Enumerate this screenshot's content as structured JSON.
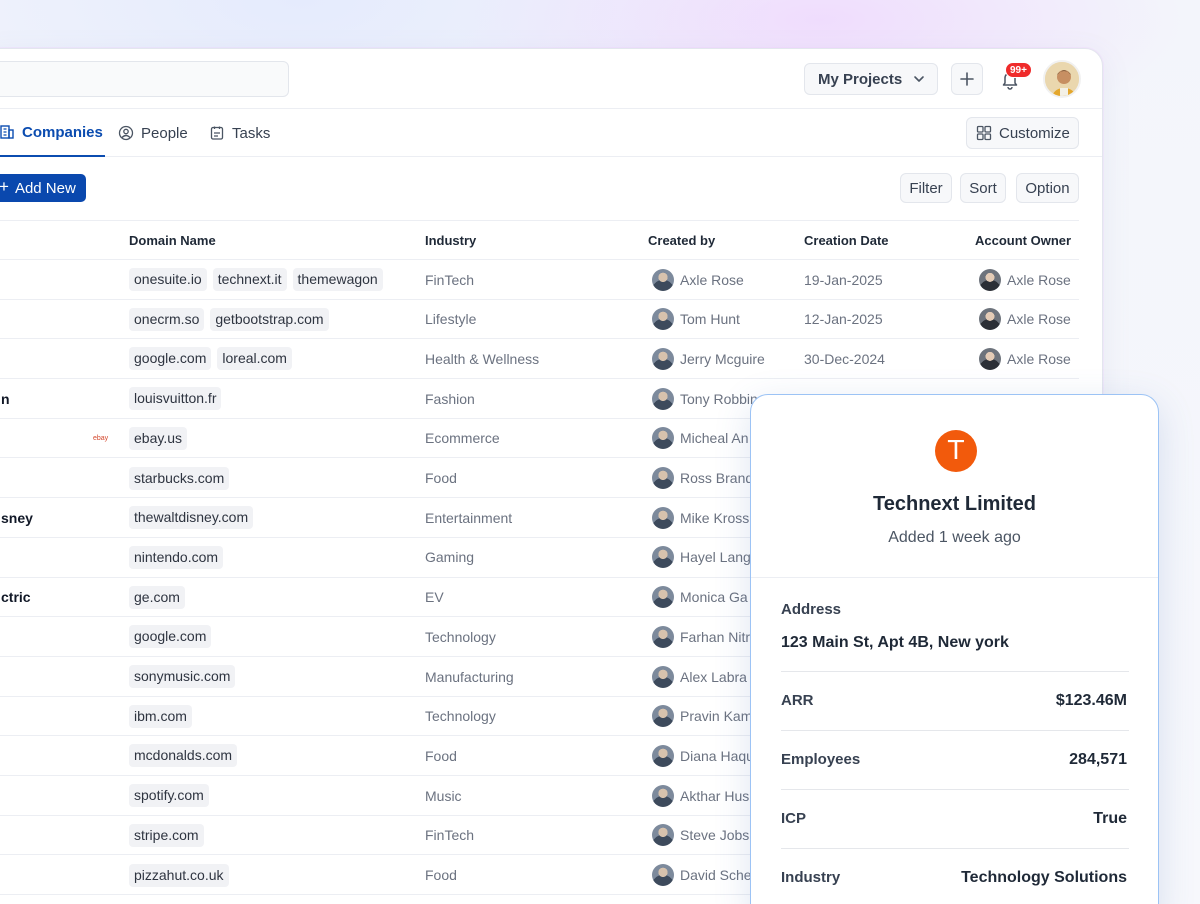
{
  "topbar": {
    "projects_label": "My Projects",
    "notification_count": "99+"
  },
  "tabs": [
    {
      "label": "Companies",
      "icon": "building-icon",
      "active": true
    },
    {
      "label": "People",
      "icon": "person-circle-icon",
      "active": false
    },
    {
      "label": "Tasks",
      "icon": "checklist-icon",
      "active": false
    }
  ],
  "customize_label": "Customize",
  "toolbar": {
    "add_new_label": "Add New",
    "filter_label": "Filter",
    "sort_label": "Sort",
    "option_label": "Option"
  },
  "table": {
    "headers": {
      "domain": "Domain Name",
      "industry": "Industry",
      "created_by": "Created by",
      "creation_date": "Creation Date",
      "owner": "Account Owner"
    },
    "rows": [
      {
        "name": "",
        "domains": [
          "onesuite.io",
          "technext.it",
          "themewagon"
        ],
        "industry": "FinTech",
        "created_by": "Axle Rose",
        "date": "19-Jan-2025",
        "owner": "Axle Rose"
      },
      {
        "name": "",
        "domains": [
          "onecrm.so",
          "getbootstrap.com"
        ],
        "industry": "Lifestyle",
        "created_by": "Tom Hunt",
        "date": "12-Jan-2025",
        "owner": "Axle Rose"
      },
      {
        "name": "",
        "domains": [
          "google.com",
          "loreal.com"
        ],
        "industry": "Health & Wellness",
        "created_by": "Jerry Mcguire",
        "date": "30-Dec-2024",
        "owner": "Axle Rose"
      },
      {
        "name": "n",
        "domains": [
          "louisvuitton.fr"
        ],
        "industry": "Fashion",
        "created_by": "Tony Robbin",
        "date": "",
        "owner": ""
      },
      {
        "name": "",
        "logo": "ebay",
        "domains": [
          "ebay.us"
        ],
        "industry": "Ecommerce",
        "created_by": "Micheal An",
        "date": "",
        "owner": ""
      },
      {
        "name": "",
        "domains": [
          "starbucks.com"
        ],
        "industry": "Food",
        "created_by": "Ross Brand",
        "date": "",
        "owner": ""
      },
      {
        "name": "sney",
        "domains": [
          "thewaltdisney.com"
        ],
        "industry": "Entertainment",
        "created_by": "Mike Kross",
        "date": "",
        "owner": ""
      },
      {
        "name": "",
        "domains": [
          "nintendo.com"
        ],
        "industry": "Gaming",
        "created_by": "Hayel Lang",
        "date": "",
        "owner": ""
      },
      {
        "name": "ctric",
        "domains": [
          "ge.com"
        ],
        "industry": "EV",
        "created_by": "Monica Ga",
        "date": "",
        "owner": ""
      },
      {
        "name": "",
        "domains": [
          "google.com"
        ],
        "industry": "Technology",
        "created_by": "Farhan Nitr",
        "date": "",
        "owner": ""
      },
      {
        "name": "",
        "domains": [
          "sonymusic.com"
        ],
        "industry": "Manufacturing",
        "created_by": "Alex Labra",
        "date": "",
        "owner": ""
      },
      {
        "name": "",
        "domains": [
          "ibm.com"
        ],
        "industry": "Technology",
        "created_by": "Pravin Kam",
        "date": "",
        "owner": ""
      },
      {
        "name": "",
        "domains": [
          "mcdonalds.com"
        ],
        "industry": "Food",
        "created_by": "Diana Haqu",
        "date": "",
        "owner": ""
      },
      {
        "name": "",
        "domains": [
          "spotify.com"
        ],
        "industry": "Music",
        "created_by": "Akthar Hus",
        "date": "",
        "owner": ""
      },
      {
        "name": "",
        "domains": [
          "stripe.com"
        ],
        "industry": "FinTech",
        "created_by": "Steve Jobs",
        "date": "",
        "owner": ""
      },
      {
        "name": "",
        "domains": [
          "pizzahut.co.uk"
        ],
        "industry": "Food",
        "created_by": "David Sche",
        "date": "",
        "owner": ""
      }
    ]
  },
  "card": {
    "logo_letter": "T",
    "logo_color": "#f25a0c",
    "title": "Technext Limited",
    "subtitle": "Added 1 week ago",
    "address_label": "Address",
    "address_value": "123 Main St, Apt 4B, New york",
    "fields": [
      {
        "label": "ARR",
        "value": "$123.46M"
      },
      {
        "label": "Employees",
        "value": "284,571"
      },
      {
        "label": "ICP",
        "value": "True"
      },
      {
        "label": "Industry",
        "value": "Technology Solutions"
      }
    ]
  },
  "colors": {
    "accent": "#0a48ae",
    "badge": "#ef2b2b"
  }
}
